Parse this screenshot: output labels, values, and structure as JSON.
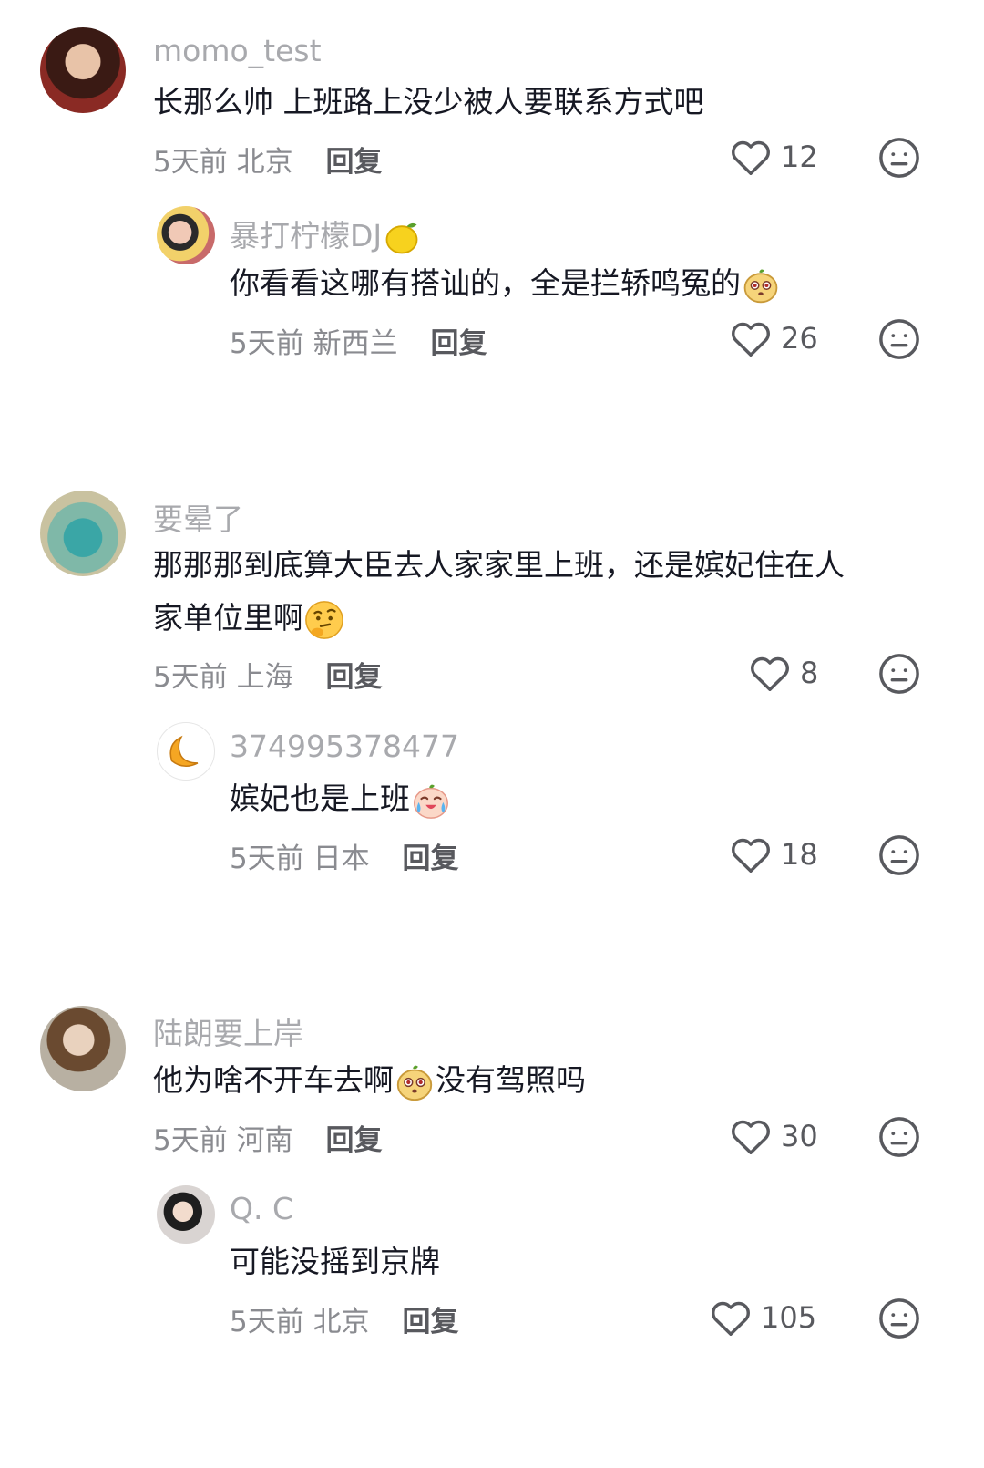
{
  "comments": [
    {
      "user": "momo_test",
      "text": "长那么帅 上班路上没少被人要联系方式吧",
      "time": "5天前",
      "location": "北京",
      "reply_label": "回复",
      "likes": "12",
      "replies": [
        {
          "user": "暴打柠檬DJ",
          "user_emoji": "lemon-emoji",
          "text": "你看看这哪有搭讪的，全是拦轿鸣冤的",
          "text_emoji": "face-emoji",
          "time": "5天前",
          "location": "新西兰",
          "reply_label": "回复",
          "likes": "26"
        }
      ]
    },
    {
      "user": "要晕了",
      "text_line1": "那那那到底算大臣去人家家里上班，还是嫔妃住在人",
      "text_line2": "家单位里啊",
      "text_emoji": "thinking-face-emoji",
      "time": "5天前",
      "location": "上海",
      "reply_label": "回复",
      "likes": "8",
      "replies": [
        {
          "user": "374995378477",
          "text": "嫔妃也是上班",
          "text_emoji": "crying-face-emoji",
          "time": "5天前",
          "location": "日本",
          "reply_label": "回复",
          "likes": "18"
        }
      ]
    },
    {
      "user": "陆朗要上岸",
      "text_part1": "他为啥不开车去啊",
      "text_part2": "没有驾照吗",
      "text_emoji": "face-emoji",
      "time": "5天前",
      "location": "河南",
      "reply_label": "回复",
      "likes": "30",
      "replies": [
        {
          "user": "Q. C",
          "text": "可能没摇到京牌",
          "time": "5天前",
          "location": "北京",
          "reply_label": "回复",
          "likes": "105"
        }
      ]
    }
  ],
  "icons": {
    "like": "heart-outline-icon",
    "dislike": "neutral-face-icon"
  },
  "colors": {
    "username": "#a8a9ad",
    "text": "#161823",
    "meta": "#8a8b90",
    "icon": "#58595e"
  }
}
